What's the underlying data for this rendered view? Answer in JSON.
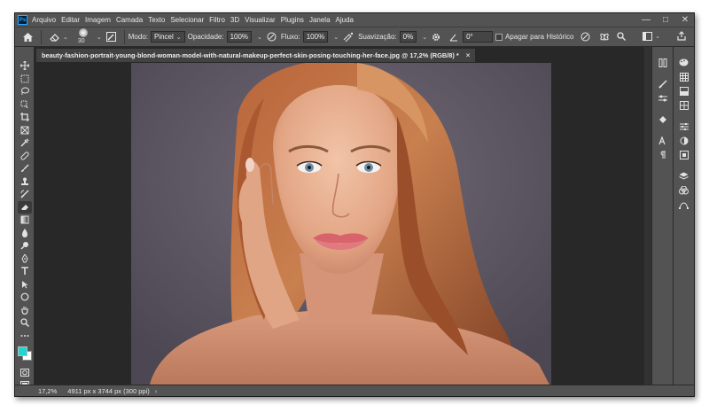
{
  "menu": {
    "items": [
      "Arquivo",
      "Editar",
      "Imagem",
      "Camada",
      "Texto",
      "Selecionar",
      "Filtro",
      "3D",
      "Visualizar",
      "Plugins",
      "Janela",
      "Ajuda"
    ],
    "logo": "Ps"
  },
  "window_controls": {
    "minimize": "—",
    "maximize": "□",
    "close": "✕"
  },
  "options": {
    "brush_size": "30",
    "mode_label": "Modo:",
    "mode_value": "Pincel",
    "opacity_label": "Opacidade:",
    "opacity_value": "100%",
    "flow_label": "Fluxo:",
    "flow_value": "100%",
    "smoothing_label": "Suavização:",
    "smoothing_value": "0%",
    "angle_value": "0°",
    "history_label": "Apagar para Histórico"
  },
  "tab": {
    "title": "beauty-fashion-portrait-young-blond-woman-model-with-natural-makeup-perfect-skin-posing-touching-her-face.jpg @ 17,2% (RGB/8) *",
    "close": "×"
  },
  "status": {
    "zoom": "17,2%",
    "info": "4911 px x 3744 px (300 ppi)",
    "arrow": "›"
  },
  "colors": {
    "foreground": "#1fd6d0",
    "background": "#ffffff",
    "ui_panel": "#535353",
    "ui_canvas": "#282828"
  },
  "tools": [
    "move-icon",
    "marquee-icon",
    "lasso-icon",
    "object-select-icon",
    "crop-icon",
    "frame-icon",
    "eyedropper-icon",
    "healing-icon",
    "brush-icon",
    "stamp-icon",
    "history-brush-icon",
    "eraser-icon",
    "gradient-icon",
    "blur-icon",
    "dodge-icon",
    "pen-icon",
    "type-icon",
    "path-select-icon",
    "shape-icon",
    "hand-icon",
    "zoom-icon",
    "more-icon"
  ]
}
